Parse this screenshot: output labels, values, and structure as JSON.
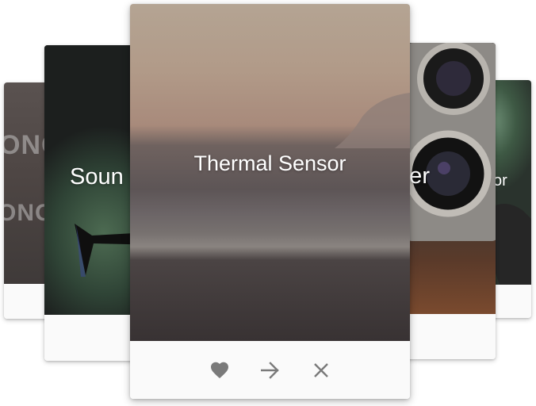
{
  "carousel": {
    "cards": [
      {
        "id": "far-left",
        "title": "",
        "image_text": "ONG"
      },
      {
        "id": "left",
        "title": "Soun"
      },
      {
        "id": "center",
        "title": "Thermal Sensor"
      },
      {
        "id": "right",
        "title": "eter"
      },
      {
        "id": "far-right",
        "title": "or"
      }
    ],
    "actions": {
      "like": "heart-icon",
      "share": "arrow-right-icon",
      "dismiss": "close-icon"
    },
    "colors": {
      "icon": "#7a7a7a",
      "footer": "#fafafa",
      "title_text": "#ffffff"
    }
  }
}
